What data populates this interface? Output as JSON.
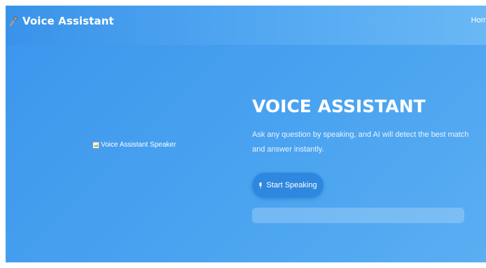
{
  "navbar": {
    "brand_title": "Voice Assistant",
    "brand_icon": "microphone-icon",
    "home_link": "Home"
  },
  "hero": {
    "image_alt": "Voice Assistant Speaker",
    "title": "VOICE ASSISTANT",
    "description": "Ask any question by speaking, and AI will detect the best match and answer instantly.",
    "button_label": "Start Speaking",
    "button_icon": "microphone-icon",
    "response_text": ""
  },
  "colors": {
    "background": "#3b95ec",
    "navbar": "#55aaf2",
    "button": "#2f88e0",
    "text": "#ffffff"
  }
}
